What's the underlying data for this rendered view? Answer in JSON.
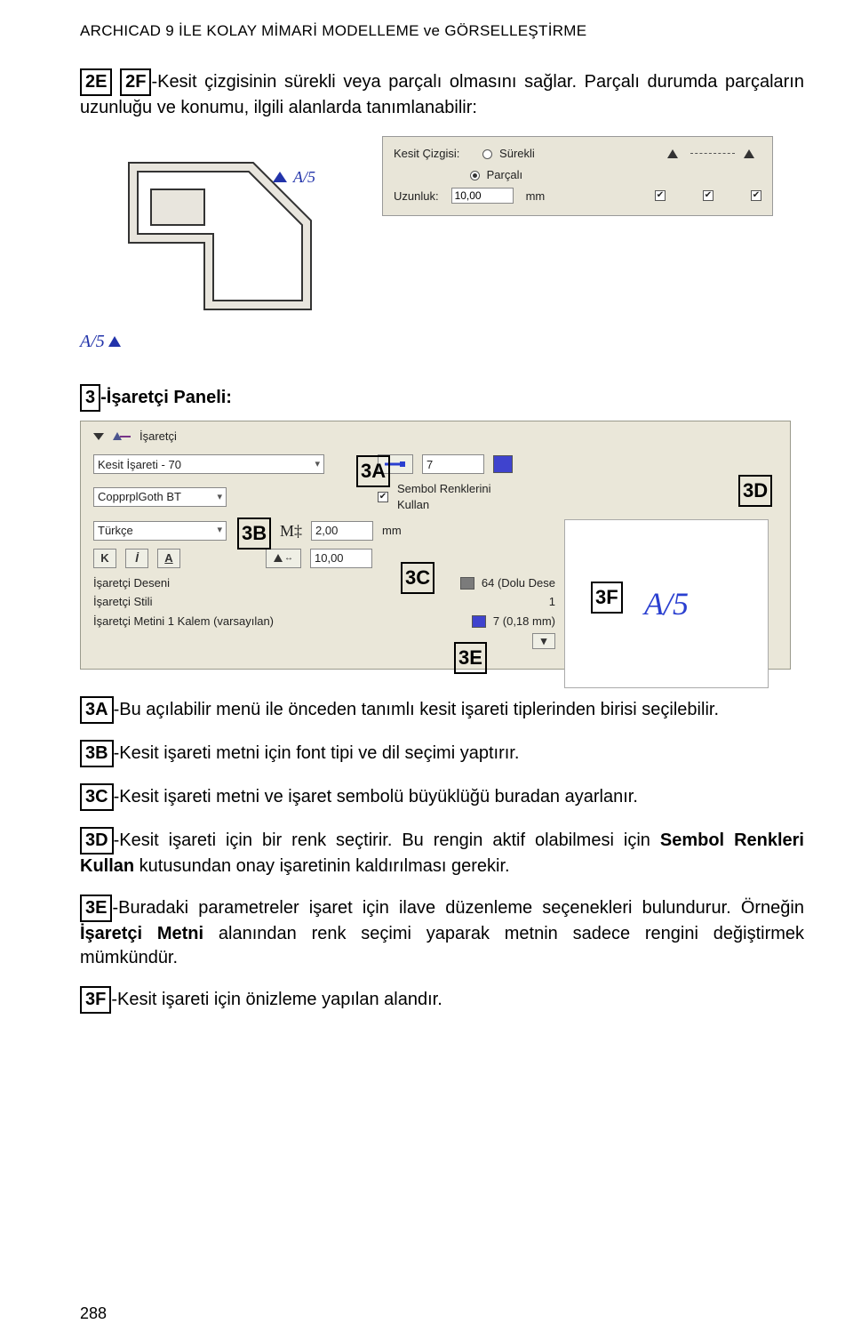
{
  "header": "ARCHICAD 9 İLE KOLAY MİMARİ MODELLEME ve GÖRSELLEŞTİRME",
  "para1": {
    "k1": "2E",
    "k2": "2F",
    "rest": "-Kesit çizgisinin sürekli veya parçalı olmasını sağlar. Parçalı durumda parçaların uzunluğu ve konumu, ilgili alanlarda tanımlanabilir:"
  },
  "floorplan": {
    "label": "A/5",
    "outer_label": "A/5"
  },
  "kc": {
    "lbl_kc": "Kesit Çizgisi:",
    "opt1": "Sürekli",
    "opt2": "Parçalı",
    "lbl_len": "Uzunluk:",
    "len_val": "10,00",
    "unit": "mm"
  },
  "sec3_title": {
    "k": "3",
    "rest": "-İşaretçi Paneli:"
  },
  "panel": {
    "title": "İşaretçi",
    "kesit_isareti": "Kesit İşareti - 70",
    "pen_val": "7",
    "font": "CopprplGoth BT",
    "chk_label": "Sembol Renklerini Kullan",
    "lang": "Türkçe",
    "Mlabel": "M‡",
    "h_val": "2,00",
    "unit": "mm",
    "K": "K",
    "I": "İ",
    "A": "A",
    "w_val": "10,00",
    "list1": "İşaretçi Deseni",
    "list1v": "64 (Dolu Dese",
    "list2": "İşaretçi Stili",
    "list2v": "1",
    "list3": "İşaretçi Metini 1 Kalem (varsayılan)",
    "list3v": "7 (0,18 mm)",
    "preview_text": "A/5",
    "ann": {
      "a": "3A",
      "b": "3B",
      "c": "3C",
      "d": "3D",
      "e": "3E",
      "f": "3F"
    }
  },
  "expl": {
    "a": {
      "k": "3A",
      "t": "-Bu açılabilir menü ile önceden tanımlı kesit işareti tiplerinden birisi seçilebilir."
    },
    "b": {
      "k": "3B",
      "t": "-Kesit işareti metni için font tipi ve dil seçimi yaptırır."
    },
    "c": {
      "k": "3C",
      "t": "-Kesit işareti metni ve işaret sembolü büyüklüğü buradan ayarlanır."
    },
    "d": {
      "k": "3D",
      "t": "-Kesit işareti için bir renk seçtirir. Bu rengin aktif olabilmesi için ",
      "bold": "Sembol Renkleri Kullan",
      "t2": " kutusundan onay işaretinin kaldırılması gerekir."
    },
    "e": {
      "k": "3E",
      "t": "-Buradaki parametreler işaret için ilave düzenleme seçenekleri bulundurur. Örneğin ",
      "bold": "İşaretçi Metni",
      "t2": " alanından renk seçimi yaparak metnin sadece rengini değiştirmek mümkündür."
    },
    "f": {
      "k": "3F",
      "t": "-Kesit işareti için önizleme yapılan alandır."
    }
  },
  "page_num": "288"
}
